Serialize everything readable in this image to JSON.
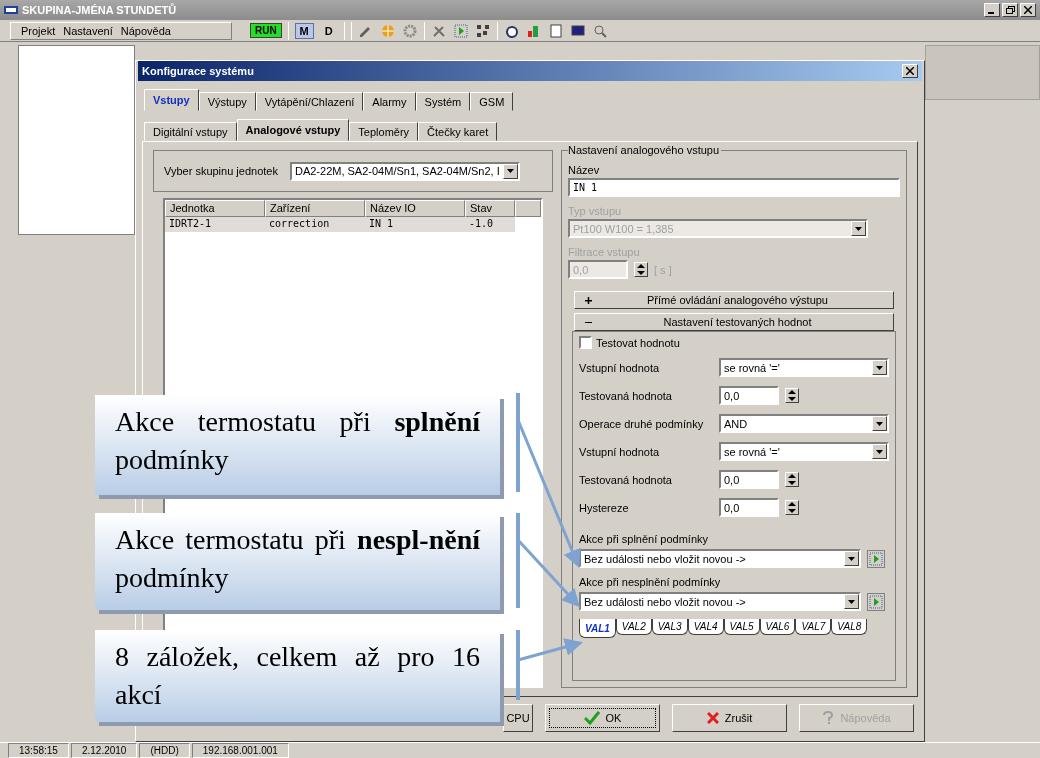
{
  "window": {
    "title": "SKUPINA-JMÉNA STUNDETŮ"
  },
  "menu": [
    "Projekt",
    "Nastavení",
    "Nápověda"
  ],
  "toolbar": {
    "run_label": "RUN",
    "modes": [
      {
        "label": "M",
        "selected": true
      },
      {
        "label": "D",
        "selected": false
      }
    ]
  },
  "dialog": {
    "title": "Konfigurace systému",
    "tabs": [
      {
        "label": "Vstupy",
        "selected": true
      },
      {
        "label": "Výstupy",
        "selected": false
      },
      {
        "label": "Vytápění/Chlazení",
        "selected": false
      },
      {
        "label": "Alarmy",
        "selected": false
      },
      {
        "label": "Systém",
        "selected": false
      },
      {
        "label": "GSM",
        "selected": false
      }
    ],
    "subtabs": [
      {
        "label": "Digitální vstupy",
        "selected": false
      },
      {
        "label": "Analogové vstupy",
        "selected": true
      },
      {
        "label": "Teploměry",
        "selected": false
      },
      {
        "label": "Čtečky karet",
        "selected": false
      }
    ],
    "group_select": {
      "label": "Vyber skupinu jednotek",
      "value": "DA2-22M, SA2-04M/Sn1, SA2-04M/Sn2, I"
    },
    "table": {
      "columns": [
        "Jednotka",
        "Zařízení",
        "Název IO",
        "Stav"
      ],
      "rows": [
        [
          "IDRT2-1",
          "correction",
          "IN 1",
          "-1.0"
        ]
      ]
    },
    "settings": {
      "title": "Nastavení analogového vstupu",
      "name_label": "Název",
      "name_value": "IN 1",
      "type_label": "Typ vstupu",
      "type_value": "Pt100 W100 = 1,385",
      "type_disabled": true,
      "filter_label": "Filtrace vstupu",
      "filter_value": "0,0",
      "filter_unit": "[ s ]",
      "filter_disabled": true
    },
    "sections": [
      {
        "label": "Přímé ovládání analogového výstupu",
        "expanded": false
      },
      {
        "label": "Nastavení testovaných hodnot",
        "expanded": true
      }
    ],
    "test": {
      "checkbox": {
        "label": "Testovat hodnotu",
        "checked": false
      },
      "rows": [
        {
          "kind": "combo",
          "label": "Vstupní hodnota",
          "value": "se rovná '='"
        },
        {
          "kind": "spin",
          "label": "Testovaná hodnota",
          "value": "0,0"
        },
        {
          "kind": "combo",
          "label": "Operace druhé podmínky",
          "value": "AND"
        },
        {
          "kind": "combo",
          "label": "Vstupní hodnota",
          "value": "se rovná '='"
        },
        {
          "kind": "spin",
          "label": "Testovaná hodnota",
          "value": "0,0"
        },
        {
          "kind": "spin",
          "label": "Hystereze",
          "value": "0,0"
        }
      ]
    },
    "actions": [
      {
        "label": "Akce při splnění podmínky",
        "value": "Bez události nebo vložit novou ->"
      },
      {
        "label": "Akce při nesplnění podmínky",
        "value": "Bez události nebo vložit novou ->"
      }
    ],
    "val_tabs": [
      {
        "label": "VAL1",
        "selected": true
      },
      {
        "label": "VAL2",
        "selected": false
      },
      {
        "label": "VAL3",
        "selected": false
      },
      {
        "label": "VAL4",
        "selected": false
      },
      {
        "label": "VAL5",
        "selected": false
      },
      {
        "label": "VAL6",
        "selected": false
      },
      {
        "label": "VAL7",
        "selected": false
      },
      {
        "label": "VAL8",
        "selected": false
      }
    ],
    "buttons": [
      {
        "kind": "cpu",
        "label": "CPU",
        "disabled": false
      },
      {
        "kind": "ok",
        "label": "OK",
        "disabled": false
      },
      {
        "kind": "cancel",
        "label": "Zrušit",
        "disabled": false
      },
      {
        "kind": "help",
        "label": "Nápověda",
        "disabled": true
      }
    ]
  },
  "status_bar": [
    "13:58:15",
    "2.12.2010",
    "(HDD)",
    "192.168.001.001"
  ],
  "callouts": [
    "Akce termostatu při **splnění** podmínky",
    "Akce termostatu při **nespl-nění** podmínky",
    "8 záložek, celkem až pro 16 akcí"
  ]
}
